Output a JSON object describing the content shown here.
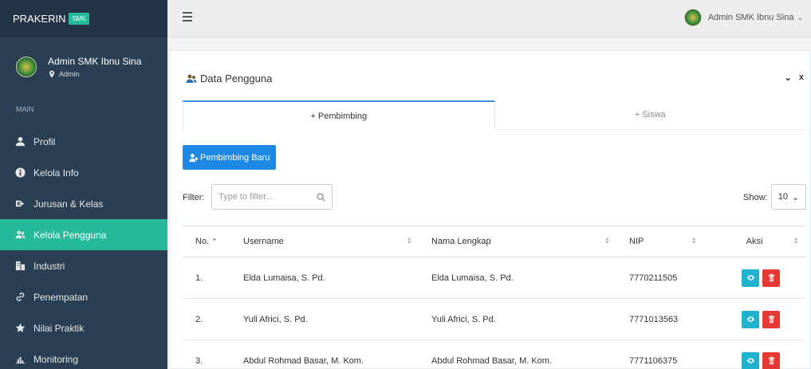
{
  "brand": {
    "name": "PRAKERIN",
    "badge": "SMK"
  },
  "profile": {
    "name": "Admin SMK Ibnu Sina",
    "role": "Admin"
  },
  "sidebar": {
    "section": "MAIN",
    "items": [
      {
        "label": "Profil",
        "icon": "user-icon",
        "active": false
      },
      {
        "label": "Kelola Info",
        "icon": "info-icon",
        "active": false
      },
      {
        "label": "Jurusan & Kelas",
        "icon": "sign-in-icon",
        "active": false
      },
      {
        "label": "Kelola Pengguna",
        "icon": "users-icon",
        "active": true
      },
      {
        "label": "Industri",
        "icon": "building-icon",
        "active": false
      },
      {
        "label": "Penempatan",
        "icon": "link-icon",
        "active": false
      },
      {
        "label": "Nilai Praktik",
        "icon": "star-icon",
        "active": false
      },
      {
        "label": "Monitoring",
        "icon": "chart-icon",
        "active": false
      }
    ]
  },
  "topbar": {
    "user": "Admin SMK Ibnu Sina",
    "chevron": "⌄"
  },
  "panel": {
    "title": "Data Pengguna",
    "collapse": "⌄",
    "close": "x",
    "tabs": [
      "+ Pembimbing",
      "+ Siswa"
    ],
    "new_button": "Pembimbing Baru",
    "filter_label": "Filter:",
    "filter_placeholder": "Type to filter...",
    "show_label": "Show:",
    "show_value": "10"
  },
  "table": {
    "columns": [
      "No.",
      "Username",
      "Nama Lengkap",
      "NIP",
      "Aksi"
    ],
    "rows": [
      {
        "no": "1.",
        "username": "Elda Lumaisa, S. Pd.",
        "nama": "Elda Lumaisa, S. Pd.",
        "nip": "7770211505"
      },
      {
        "no": "2.",
        "username": "Yuli Africi, S. Pd.",
        "nama": "Yuli Africi, S. Pd.",
        "nip": "7771013563"
      },
      {
        "no": "3.",
        "username": "Abdul Rohmad Basar, M. Kom.",
        "nama": "Abdul Rohmad Basar, M. Kom.",
        "nip": "7771106375"
      }
    ]
  },
  "colors": {
    "sidebar": "#2a3f54",
    "accent": "#26b99a",
    "primary": "#1e88e5",
    "info": "#1fb3cf",
    "danger": "#e53935"
  }
}
